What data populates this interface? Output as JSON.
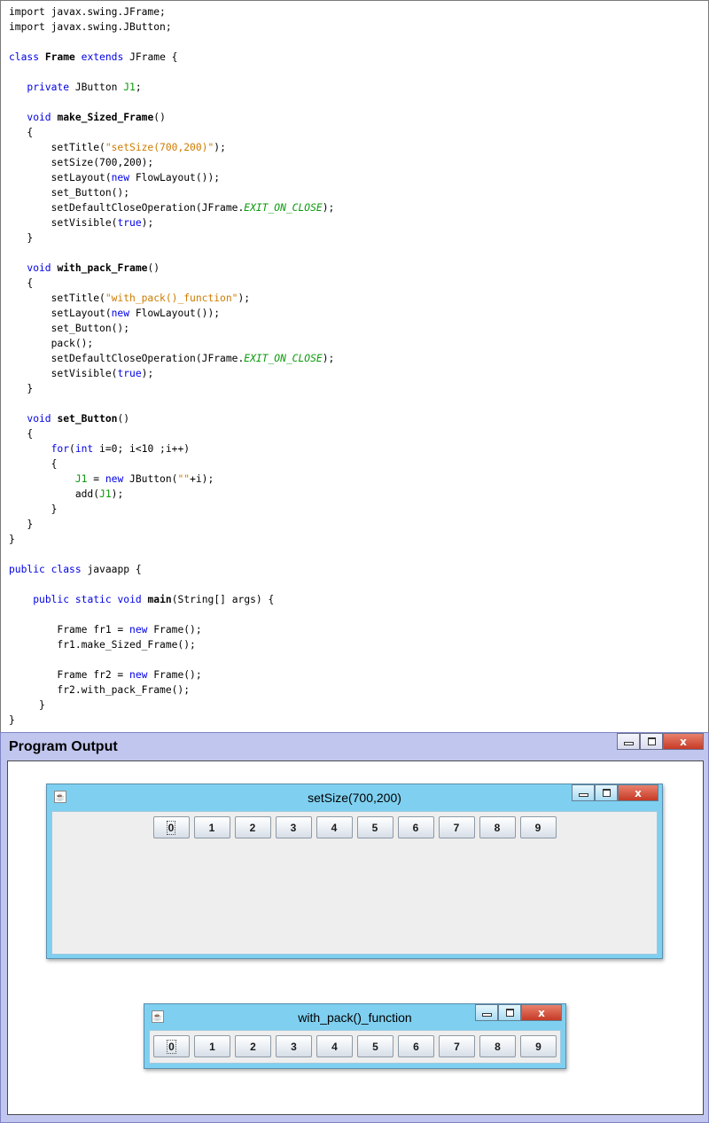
{
  "code": {
    "lines": [
      [
        {
          "t": "import javax.swing.JFrame;",
          "c": "plain"
        }
      ],
      [
        {
          "t": "import javax.swing.JButton;",
          "c": "plain"
        }
      ],
      [],
      [
        {
          "t": "class",
          "c": "kw"
        },
        {
          "t": " ",
          "c": "plain"
        },
        {
          "t": "Frame",
          "c": "bold"
        },
        {
          "t": " ",
          "c": "plain"
        },
        {
          "t": "extends",
          "c": "kw"
        },
        {
          "t": " JFrame {",
          "c": "plain"
        }
      ],
      [],
      [
        {
          "t": "   ",
          "c": "plain"
        },
        {
          "t": "private",
          "c": "kw"
        },
        {
          "t": " JButton ",
          "c": "plain"
        },
        {
          "t": "J1",
          "c": "fld"
        },
        {
          "t": ";",
          "c": "plain"
        }
      ],
      [],
      [
        {
          "t": "   ",
          "c": "plain"
        },
        {
          "t": "void",
          "c": "kw"
        },
        {
          "t": " ",
          "c": "plain"
        },
        {
          "t": "make_Sized_Frame",
          "c": "bold"
        },
        {
          "t": "()",
          "c": "plain"
        }
      ],
      [
        {
          "t": "   {",
          "c": "plain"
        }
      ],
      [
        {
          "t": "       setTitle(",
          "c": "plain"
        },
        {
          "t": "\"setSize(700,200)\"",
          "c": "str"
        },
        {
          "t": ");",
          "c": "plain"
        }
      ],
      [
        {
          "t": "       setSize(700,200);",
          "c": "plain"
        }
      ],
      [
        {
          "t": "       setLayout(",
          "c": "plain"
        },
        {
          "t": "new",
          "c": "kw"
        },
        {
          "t": " FlowLayout());",
          "c": "plain"
        }
      ],
      [
        {
          "t": "       set_Button();",
          "c": "plain"
        }
      ],
      [
        {
          "t": "       setDefaultCloseOperation(JFrame.",
          "c": "plain"
        },
        {
          "t": "EXIT_ON_CLOSE",
          "c": "static"
        },
        {
          "t": ");",
          "c": "plain"
        }
      ],
      [
        {
          "t": "       setVisible(",
          "c": "plain"
        },
        {
          "t": "true",
          "c": "kw"
        },
        {
          "t": ");",
          "c": "plain"
        }
      ],
      [
        {
          "t": "   }",
          "c": "plain"
        }
      ],
      [],
      [
        {
          "t": "   ",
          "c": "plain"
        },
        {
          "t": "void",
          "c": "kw"
        },
        {
          "t": " ",
          "c": "plain"
        },
        {
          "t": "with_pack_Frame",
          "c": "bold"
        },
        {
          "t": "()",
          "c": "plain"
        }
      ],
      [
        {
          "t": "   {",
          "c": "plain"
        }
      ],
      [
        {
          "t": "       setTitle(",
          "c": "plain"
        },
        {
          "t": "\"with_pack()_function\"",
          "c": "str"
        },
        {
          "t": ");",
          "c": "plain"
        }
      ],
      [
        {
          "t": "       setLayout(",
          "c": "plain"
        },
        {
          "t": "new",
          "c": "kw"
        },
        {
          "t": " FlowLayout());",
          "c": "plain"
        }
      ],
      [
        {
          "t": "       set_Button();",
          "c": "plain"
        }
      ],
      [
        {
          "t": "       pack();",
          "c": "plain"
        }
      ],
      [
        {
          "t": "       setDefaultCloseOperation(JFrame.",
          "c": "plain"
        },
        {
          "t": "EXIT_ON_CLOSE",
          "c": "static"
        },
        {
          "t": ");",
          "c": "plain"
        }
      ],
      [
        {
          "t": "       setVisible(",
          "c": "plain"
        },
        {
          "t": "true",
          "c": "kw"
        },
        {
          "t": ");",
          "c": "plain"
        }
      ],
      [
        {
          "t": "   }",
          "c": "plain"
        }
      ],
      [],
      [
        {
          "t": "   ",
          "c": "plain"
        },
        {
          "t": "void",
          "c": "kw"
        },
        {
          "t": " ",
          "c": "plain"
        },
        {
          "t": "set_Button",
          "c": "bold"
        },
        {
          "t": "()",
          "c": "plain"
        }
      ],
      [
        {
          "t": "   {",
          "c": "plain"
        }
      ],
      [
        {
          "t": "       ",
          "c": "plain"
        },
        {
          "t": "for",
          "c": "kw"
        },
        {
          "t": "(",
          "c": "plain"
        },
        {
          "t": "int",
          "c": "kw"
        },
        {
          "t": " i=0; i<10 ;i++)",
          "c": "plain"
        }
      ],
      [
        {
          "t": "       {",
          "c": "plain"
        }
      ],
      [
        {
          "t": "           ",
          "c": "plain"
        },
        {
          "t": "J1",
          "c": "fld"
        },
        {
          "t": " = ",
          "c": "plain"
        },
        {
          "t": "new",
          "c": "kw"
        },
        {
          "t": " JButton(",
          "c": "plain"
        },
        {
          "t": "\"\"",
          "c": "str"
        },
        {
          "t": "+i);",
          "c": "plain"
        }
      ],
      [
        {
          "t": "           add(",
          "c": "plain"
        },
        {
          "t": "J1",
          "c": "fld"
        },
        {
          "t": ");",
          "c": "plain"
        }
      ],
      [
        {
          "t": "       }",
          "c": "plain"
        }
      ],
      [
        {
          "t": "   }",
          "c": "plain"
        }
      ],
      [
        {
          "t": "}",
          "c": "plain"
        }
      ],
      [],
      [
        {
          "t": "public",
          "c": "kw"
        },
        {
          "t": " ",
          "c": "plain"
        },
        {
          "t": "class",
          "c": "kw"
        },
        {
          "t": " javaapp {",
          "c": "plain"
        }
      ],
      [],
      [
        {
          "t": "    ",
          "c": "plain"
        },
        {
          "t": "public",
          "c": "kw"
        },
        {
          "t": " ",
          "c": "plain"
        },
        {
          "t": "static",
          "c": "kw"
        },
        {
          "t": " ",
          "c": "plain"
        },
        {
          "t": "void",
          "c": "kw"
        },
        {
          "t": " ",
          "c": "plain"
        },
        {
          "t": "main",
          "c": "bold"
        },
        {
          "t": "(String[] args) {",
          "c": "plain"
        }
      ],
      [],
      [
        {
          "t": "        Frame fr1 = ",
          "c": "plain"
        },
        {
          "t": "new",
          "c": "kw"
        },
        {
          "t": " Frame();",
          "c": "plain"
        }
      ],
      [
        {
          "t": "        fr1.make_Sized_Frame();",
          "c": "plain"
        }
      ],
      [],
      [
        {
          "t": "        Frame fr2 = ",
          "c": "plain"
        },
        {
          "t": "new",
          "c": "kw"
        },
        {
          "t": " Frame();",
          "c": "plain"
        }
      ],
      [
        {
          "t": "        fr2.with_pack_Frame();",
          "c": "plain"
        }
      ],
      [
        {
          "t": "     }",
          "c": "plain"
        }
      ],
      [
        {
          "t": "}",
          "c": "plain"
        }
      ]
    ]
  },
  "output": {
    "title": "Program Output",
    "close_glyph": "x",
    "frames": [
      {
        "title": "setSize(700,200)",
        "icon": "java-cup-icon",
        "close_glyph": "x",
        "buttons": [
          "0",
          "1",
          "2",
          "3",
          "4",
          "5",
          "6",
          "7",
          "8",
          "9"
        ],
        "focused_index": 0
      },
      {
        "title": "with_pack()_function",
        "icon": "java-cup-icon",
        "close_glyph": "x",
        "buttons": [
          "0",
          "1",
          "2",
          "3",
          "4",
          "5",
          "6",
          "7",
          "8",
          "9"
        ],
        "focused_index": 0
      }
    ]
  }
}
